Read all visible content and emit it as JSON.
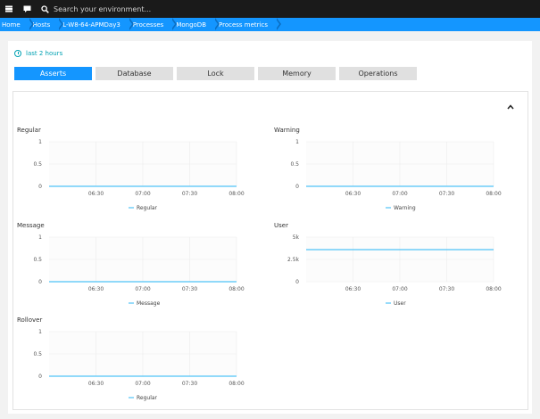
{
  "topbar": {
    "search_placeholder": "Search your environment..."
  },
  "breadcrumb": [
    "Home",
    "Hosts",
    "L-W8-64-APMDay3",
    "Processes",
    "MongoDB",
    "Process metrics"
  ],
  "timeframe": {
    "label": "last 2 hours"
  },
  "tabs": [
    {
      "label": "Asserts",
      "active": true
    },
    {
      "label": "Database",
      "active": false
    },
    {
      "label": "Lock",
      "active": false
    },
    {
      "label": "Memory",
      "active": false
    },
    {
      "label": "Operations",
      "active": false
    }
  ],
  "colors": {
    "accent": "#1496ff",
    "series": "#4fc3f7",
    "link": "#00a1b2"
  },
  "chart_data": [
    {
      "type": "line",
      "title": "Regular",
      "x": [
        "06:30",
        "07:00",
        "07:30",
        "08:00"
      ],
      "yticks": [
        "1",
        "0.5",
        "0"
      ],
      "ylim": [
        0,
        1
      ],
      "series": [
        {
          "name": "Regular",
          "values": [
            0,
            0,
            0,
            0
          ]
        }
      ]
    },
    {
      "type": "line",
      "title": "Warning",
      "x": [
        "06:30",
        "07:00",
        "07:30",
        "08:00"
      ],
      "yticks": [
        "1",
        "0.5",
        "0"
      ],
      "ylim": [
        0,
        1
      ],
      "series": [
        {
          "name": "Warning",
          "values": [
            0,
            0,
            0,
            0
          ]
        }
      ]
    },
    {
      "type": "line",
      "title": "Message",
      "x": [
        "06:30",
        "07:00",
        "07:30",
        "08:00"
      ],
      "yticks": [
        "1",
        "0.5",
        "0"
      ],
      "ylim": [
        0,
        1
      ],
      "series": [
        {
          "name": "Message",
          "values": [
            0,
            0,
            0,
            0
          ]
        }
      ]
    },
    {
      "type": "line",
      "title": "User",
      "x": [
        "06:30",
        "07:00",
        "07:30",
        "08:00"
      ],
      "yticks": [
        "5k",
        "2.5k",
        "0"
      ],
      "ylim": [
        0,
        5000
      ],
      "series": [
        {
          "name": "User",
          "values": [
            3600,
            3600,
            3600,
            3600
          ]
        }
      ]
    },
    {
      "type": "line",
      "title": "Rollover",
      "x": [
        "06:30",
        "07:00",
        "07:30",
        "08:00"
      ],
      "yticks": [
        "1",
        "0.5",
        "0"
      ],
      "ylim": [
        0,
        1
      ],
      "series": [
        {
          "name": "Regular",
          "values": [
            0,
            0,
            0,
            0
          ]
        }
      ]
    }
  ]
}
